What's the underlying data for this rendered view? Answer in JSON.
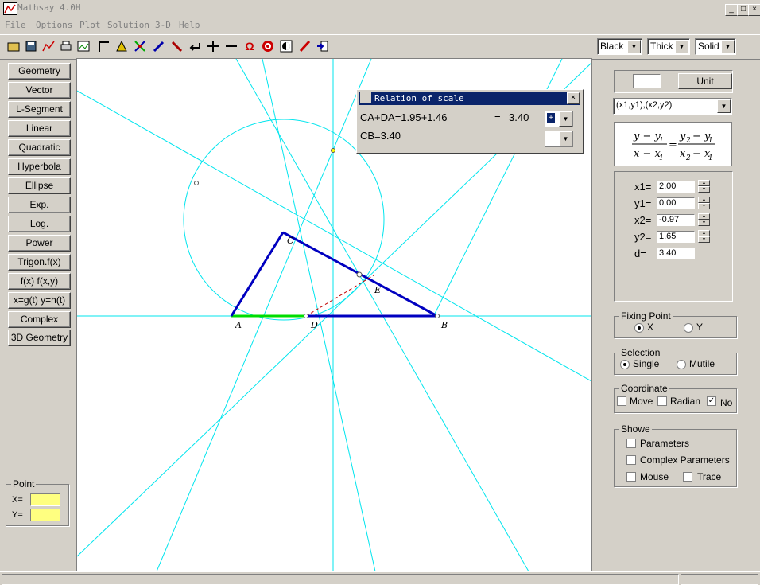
{
  "window": {
    "title": "Mathsay 4.0H",
    "minimize": "_",
    "maximize": "□",
    "close": "×"
  },
  "menu": [
    "File",
    "Options",
    "Plot",
    "Solution",
    "3-D",
    "Help"
  ],
  "toolbar": {
    "icons": [
      "open-icon",
      "save-icon",
      "chart-icon",
      "print-icon",
      "image-icon",
      "axis-corner-icon",
      "paint-icon",
      "intersect-icon",
      "pen-icon",
      "compass-icon",
      "arrow-left-icon",
      "plus-icon",
      "minus-icon",
      "omega-icon",
      "target-icon",
      "contrast-icon",
      "pencil-icon",
      "exit-icon"
    ],
    "color": "Black",
    "width": "Thick",
    "style": "Solid"
  },
  "left_buttons": [
    "Geometry",
    "Vector",
    "L-Segment",
    "Linear",
    "Quadratic",
    "Hyperbola",
    "Ellipse",
    "Exp.",
    "Log.",
    "Power",
    "Trigon.f(x)",
    "f(x)  f(x,y)",
    "x=g(t) y=h(t)",
    "Complex",
    "3D Geometry"
  ],
  "point_panel": {
    "legend": "Point",
    "x_label": "X=",
    "y_label": "Y=",
    "x_value": "",
    "y_value": ""
  },
  "dialog": {
    "title": "Relation of scale",
    "line1": "CA+DA=1.95+1.46",
    "equals": "=",
    "result": "3.40",
    "line2": "CB=3.40",
    "close": "×"
  },
  "figure": {
    "labels": {
      "A": "A",
      "B": "B",
      "C": "C",
      "D": "D",
      "E": "E"
    }
  },
  "right_panel": {
    "unit_value": "",
    "unit_button": "Unit",
    "formula_select": "(x1,y1),(x2,y2)",
    "params": [
      {
        "label": "x1=",
        "value": "2.00"
      },
      {
        "label": "y1=",
        "value": "0.00"
      },
      {
        "label": "x2=",
        "value": "-0.97"
      },
      {
        "label": "y2=",
        "value": "1.65"
      },
      {
        "label": "d=",
        "value": "3.40"
      }
    ],
    "fixing_point": {
      "legend": "Fixing Point",
      "options": [
        "X",
        "Y"
      ],
      "selected": "X"
    },
    "selection": {
      "legend": "Selection",
      "options": [
        "Single",
        "Mutile"
      ],
      "selected": "Single"
    },
    "coordinate": {
      "legend": "Coordinate",
      "options": [
        "Move",
        "Radian",
        "No"
      ],
      "checked": [
        "No"
      ]
    },
    "showe": {
      "legend": "Showe",
      "options": [
        "Parameters",
        "Complex Parameters",
        "Mouse",
        "Trace"
      ]
    }
  },
  "colors": {
    "canvas_line": "#00e5ee",
    "triangle": "#0000c0",
    "segment_ad": "#00dd00",
    "dashed": "#c00000",
    "titlebar": "#0a246a",
    "point_input": "#ffff80"
  }
}
